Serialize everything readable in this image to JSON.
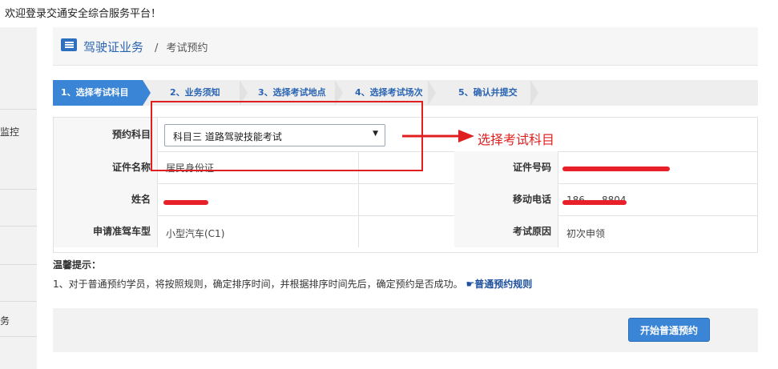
{
  "welcome": "欢迎登录交通安全综合服务平台！",
  "sidebar": {
    "items": [
      "监控",
      "务"
    ]
  },
  "breadcrumb": {
    "main": "驾驶证业务",
    "sep": "/",
    "sub": "考试预约"
  },
  "steps": [
    "1、选择考试科目",
    "2、业务须知",
    "3、选择考试地点",
    "4、选择考试场次",
    "5、确认并提交"
  ],
  "form": {
    "subject_label": "预约科目",
    "subject_value": "科目三 道路驾驶技能考试",
    "cert_name_label": "证件名称",
    "cert_name_value": "居民身份证",
    "cert_no_label": "证件号码",
    "name_label": "姓名",
    "phone_label": "移动电话",
    "phone_partial_left": "186",
    "phone_partial_right": "8804",
    "car_type_label": "申请准驾车型",
    "car_type_value": "小型汽车(C1)",
    "reason_label": "考试原因",
    "reason_value": "初次申领"
  },
  "annotation": "选择考试科目",
  "tips": {
    "title": "温馨提示：",
    "line": "1、对于普通预约学员，将按照规则，确定排序时间，并根据排序时间先后，确定预约是否成功。",
    "link": "☛普通预约规则"
  },
  "button": "开始普通预约",
  "colors": {
    "accent": "#3a85d6",
    "annotation": "#e02020"
  }
}
